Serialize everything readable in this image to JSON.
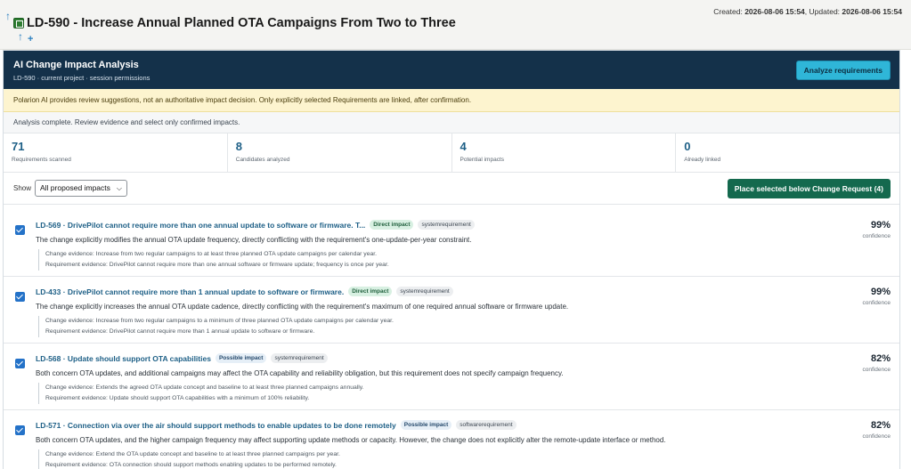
{
  "header": {
    "title": "LD-590 - Increase Annual Planned OTA Campaigns From Two to Three",
    "created_label": "Created:",
    "created_value": "2026-08-06 15:54",
    "updated_label": "Updated:",
    "updated_value": "2026-08-06 15:54"
  },
  "panel": {
    "title": "AI Change Impact Analysis",
    "subtitle": "LD-590 · current project · session permissions",
    "analyze_label": "Analyze requirements"
  },
  "warning": "Polarion AI provides review suggestions, not an authoritative impact decision. Only explicitly selected Requirements are linked, after confirmation.",
  "status": "Analysis complete. Review evidence and select only confirmed impacts.",
  "stats": [
    {
      "value": "71",
      "label": "Requirements scanned"
    },
    {
      "value": "8",
      "label": "Candidates analyzed"
    },
    {
      "value": "4",
      "label": "Potential impacts"
    },
    {
      "value": "0",
      "label": "Already linked"
    }
  ],
  "filter": {
    "label": "Show",
    "selected": "All proposed impacts",
    "place_label": "Place selected below Change Request (4)"
  },
  "items": [
    {
      "checked": true,
      "title": "LD-569 · DrivePilot cannot require more than one annual update to software or firmware. T...",
      "impact": "Direct impact",
      "type": "systemrequirement",
      "desc": "The change explicitly modifies the annual OTA update frequency, directly conflicting with the requirement's one-update-per-year constraint.",
      "change_evidence": "Change evidence: Increase from two regular campaigns to at least three planned OTA update campaigns per calendar year.",
      "req_evidence": "Requirement evidence: DrivePilot cannot require more than one annual software or firmware update; frequency is once per year.",
      "confidence": "99%",
      "confidence_label": "confidence"
    },
    {
      "checked": true,
      "title": "LD-433 · DrivePilot cannot require more than 1 annual update to software or firmware.",
      "impact": "Direct impact",
      "type": "systemrequirement",
      "desc": "The change explicitly increases the annual OTA update cadence, directly conflicting with the requirement's maximum of one required annual software or firmware update.",
      "change_evidence": "Change evidence: Increase from two regular campaigns to a minimum of three planned OTA update campaigns per calendar year.",
      "req_evidence": "Requirement evidence: DrivePilot cannot require more than 1 annual update to software or firmware.",
      "confidence": "99%",
      "confidence_label": "confidence"
    },
    {
      "checked": true,
      "title": "LD-568 · Update should support OTA capabilities",
      "impact": "Possible impact",
      "type": "systemrequirement",
      "desc": "Both concern OTA updates, and additional campaigns may affect the OTA capability and reliability obligation, but this requirement does not specify campaign frequency.",
      "change_evidence": "Change evidence: Extends the agreed OTA update concept and baseline to at least three planned campaigns annually.",
      "req_evidence": "Requirement evidence: Update should support OTA capabilities with a minimum of 100% reliability.",
      "confidence": "82%",
      "confidence_label": "confidence"
    },
    {
      "checked": true,
      "title": "LD-571 · Connection via over the air should support methods to enable updates to be done remotely",
      "impact": "Possible impact",
      "type": "softwarerequirement",
      "desc": "Both concern OTA updates, and the higher campaign frequency may affect supporting update methods or capacity. However, the change does not explicitly alter the remote-update interface or method.",
      "change_evidence": "Change evidence: Extend the OTA update concept and baseline to at least three planned campaigns per year.",
      "req_evidence": "Requirement evidence: OTA connection should support methods enabling updates to be performed remotely.",
      "confidence": "82%",
      "confidence_label": "confidence"
    }
  ]
}
